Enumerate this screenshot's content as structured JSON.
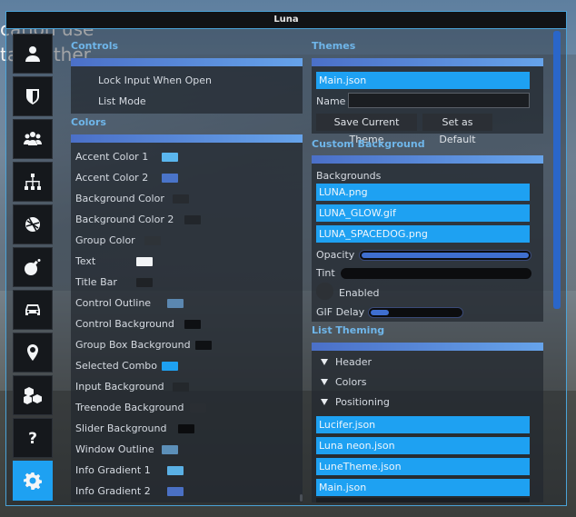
{
  "background": {
    "line1": "cation use",
    "line2": "tate other"
  },
  "window": {
    "title": "Luna"
  },
  "nav": {
    "items": [
      {
        "icon": "user-icon",
        "active": false
      },
      {
        "icon": "shield-icon",
        "active": false
      },
      {
        "icon": "users-group-icon",
        "active": false
      },
      {
        "icon": "hierarchy-icon",
        "active": false
      },
      {
        "icon": "ball-icon",
        "active": false
      },
      {
        "icon": "bomb-icon",
        "active": false
      },
      {
        "icon": "car-icon",
        "active": false
      },
      {
        "icon": "map-pin-icon",
        "active": false
      },
      {
        "icon": "cubes-icon",
        "active": false
      },
      {
        "icon": "question-icon",
        "active": false
      },
      {
        "icon": "gear-icon",
        "active": true
      }
    ]
  },
  "controls": {
    "title": "Controls",
    "lock_input": "Lock Input When Open",
    "list_mode": "List Mode"
  },
  "colors": {
    "title": "Colors",
    "items": [
      {
        "label": "Accent Color 1",
        "color": "#5ab6ee"
      },
      {
        "label": "Accent Color 2",
        "color": "#4a74c9"
      },
      {
        "label": "Background Color",
        "color": "#272b30"
      },
      {
        "label": "Background Color 2",
        "color": "#22262b"
      },
      {
        "label": "Group Color",
        "color": "#2e3338"
      },
      {
        "label": "Text",
        "color": "#f2f4f6"
      },
      {
        "label": "Title Bar",
        "color": "#1f2226"
      },
      {
        "label": "Control Outline",
        "color": "#5b87b0"
      },
      {
        "label": "Control Background",
        "color": "#0e1013"
      },
      {
        "label": "Group Box Background",
        "color": "#0f1114"
      },
      {
        "label": "Selected Combo",
        "color": "#1ea1f2"
      },
      {
        "label": "Input Background",
        "color": "#24282c"
      },
      {
        "label": "Treenode Background",
        "color": "#2a2e33"
      },
      {
        "label": "Slider Background",
        "color": "#0b0c0e"
      },
      {
        "label": "Window Outline",
        "color": "#5c8fb8"
      },
      {
        "label": "Info Gradient 1",
        "color": "#5ab0e4"
      },
      {
        "label": "Info Gradient 2",
        "color": "#4a70c4"
      }
    ]
  },
  "themes": {
    "title": "Themes",
    "selected": "Main.json",
    "name_label": "Name",
    "name_value": "",
    "save_button": "Save Current Theme",
    "default_button": "Set as Default"
  },
  "custom_background": {
    "title": "Custom Background",
    "backgrounds_label": "Backgrounds",
    "items": [
      "LUNA.png",
      "LUNA_GLOW.gif",
      "LUNA_SPACEDOG.png"
    ],
    "opacity_label": "Opacity",
    "opacity_value": 1.0,
    "tint_label": "Tint",
    "enabled_label": "Enabled",
    "gif_delay_label": "GIF Delay",
    "gif_delay_value": 0.2
  },
  "list_theming": {
    "title": "List Theming",
    "tree": [
      "Header",
      "Colors",
      "Positioning"
    ],
    "items": [
      "Lucifer.json",
      "Luna neon.json",
      "LuneTheme.json",
      "Main.json"
    ]
  },
  "accent": "#1ea1f2"
}
